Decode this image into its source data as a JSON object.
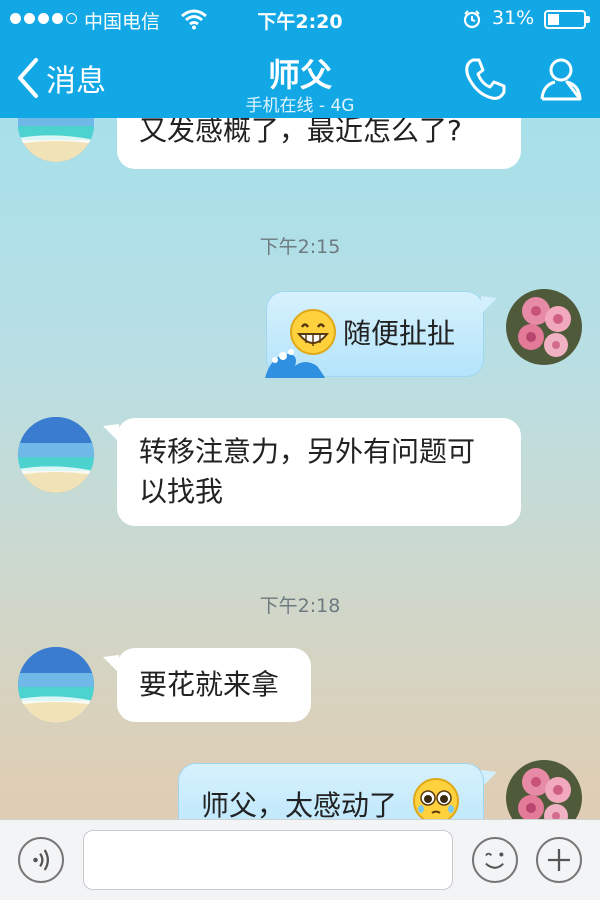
{
  "status_bar": {
    "carrier": "中国电信",
    "time": "下午2:20",
    "battery_percent": "31%",
    "battery_level": 0.31,
    "signal_bars": 4,
    "icons": [
      "wifi-icon",
      "alarm-icon",
      "battery-icon"
    ]
  },
  "nav": {
    "back_label": "消息",
    "title": "师父",
    "subtitle": "手机在线 - 4G",
    "icons": [
      "chevron-left-icon",
      "phone-icon",
      "profile-icon"
    ],
    "accent_color": "#12a8e6"
  },
  "messages": [
    {
      "type": "text",
      "side": "left",
      "text": "又发感概了，最近怎么了?"
    },
    {
      "type": "timestamp",
      "text": "下午2:15"
    },
    {
      "type": "text",
      "side": "right",
      "text": "随便扯扯",
      "emoji": "grin-emoji"
    },
    {
      "type": "text",
      "side": "left",
      "lines": [
        "转移注意力，另外有问题可",
        "以找我"
      ]
    },
    {
      "type": "timestamp",
      "text": "下午2:18"
    },
    {
      "type": "text",
      "side": "left",
      "text": "要花就来拿"
    },
    {
      "type": "text",
      "side": "right",
      "text": "师父，太感动了",
      "emoji": "teary-emoji"
    }
  ],
  "input_bar": {
    "placeholder": "",
    "value": "",
    "icons": [
      "voice-icon",
      "emoji-icon",
      "plus-icon"
    ]
  }
}
